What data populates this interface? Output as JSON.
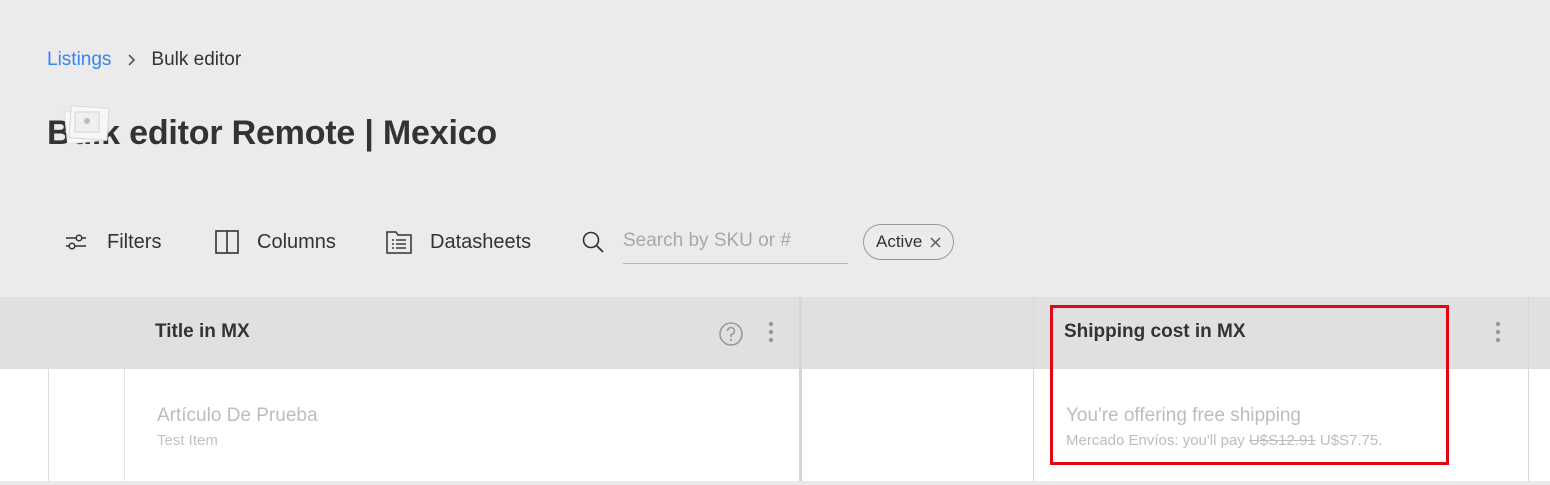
{
  "breadcrumb": {
    "parent": "Listings",
    "current": "Bulk editor"
  },
  "page": {
    "title": "Bulk editor Remote | Mexico"
  },
  "toolbar": {
    "filters_label": "Filters",
    "columns_label": "Columns",
    "datasheets_label": "Datasheets",
    "search_placeholder": "Search by SKU or #",
    "search_value": "",
    "chip_label": "Active"
  },
  "table": {
    "columns": [
      {
        "header": "Title in MX"
      },
      {
        "header": ""
      },
      {
        "header": "Shipping cost in MX"
      }
    ],
    "rows": [
      {
        "title": "Artículo De Prueba",
        "subtitle": "Test Item",
        "shipping_main": "You're offering free shipping",
        "shipping_prefix": "Mercado Envíos: you'll pay",
        "shipping_old_price": "U$S12.91",
        "shipping_new_price": "U$S7.75."
      }
    ]
  },
  "colors": {
    "link": "#3483fa",
    "highlight": "#e30613",
    "header_bg": "#e0e0e0",
    "page_bg": "#ebebeb"
  },
  "icons": [
    "chevron-right-icon",
    "sliders-icon",
    "columns-icon",
    "datasheet-icon",
    "search-icon",
    "close-icon",
    "help-icon",
    "kebab-menu-icon",
    "image-placeholder-icon"
  ]
}
